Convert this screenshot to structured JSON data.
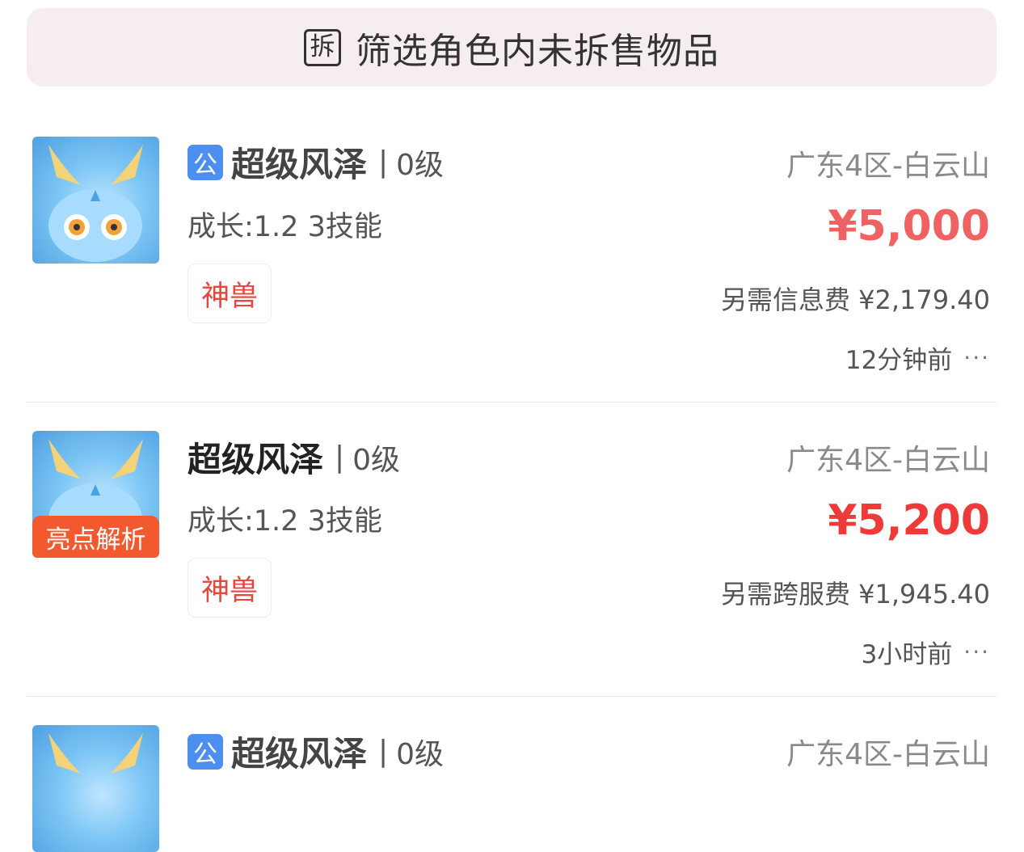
{
  "filter": {
    "icon_char": "拆",
    "label": "筛选角色内未拆售物品"
  },
  "listings": [
    {
      "public_badge": "公",
      "name": "超级风泽",
      "level": "0级",
      "attrs": "成长:1.2 3技能",
      "tag": "神兽",
      "server": "广东4区-白云山",
      "price": "¥5,000",
      "fee": "另需信息费 ¥2,179.40",
      "time": "12分钟前",
      "highlight_badge": null
    },
    {
      "public_badge": null,
      "name": "超级风泽",
      "level": "0级",
      "attrs": "成长:1.2 3技能",
      "tag": "神兽",
      "server": "广东4区-白云山",
      "price": "¥5,200",
      "fee": "另需跨服费 ¥1,945.40",
      "time": "3小时前",
      "highlight_badge": "亮点解析"
    },
    {
      "public_badge": "公",
      "name": "超级风泽",
      "level": "0级",
      "server": "广东4区-白云山"
    }
  ],
  "separator": "|",
  "more_glyph": "···",
  "colors": {
    "price_red": "#ef3a3a",
    "badge_blue": "#4c8ff1",
    "highlight_orange": "#f2592f",
    "filter_bg": "#f6edf3"
  }
}
